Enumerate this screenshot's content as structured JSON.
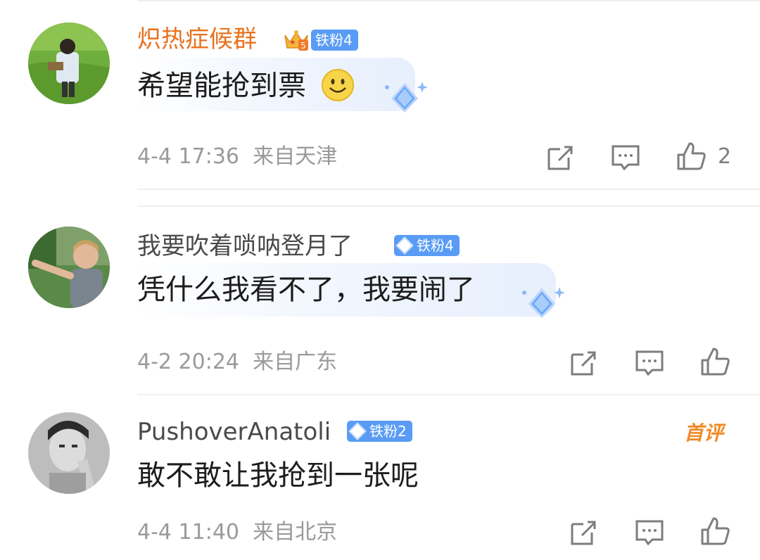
{
  "comments": [
    {
      "username": "炽热症候群",
      "username_color": "#e8711f",
      "fan_badge": "铁粉4",
      "has_crown": true,
      "crown_level": "5",
      "content": "希望能抢到票",
      "emoji": "smiley-emoji",
      "timestamp": "4-4 17:36",
      "location": "来自天津",
      "likes": "2"
    },
    {
      "username": "我要吹着唢呐登月了",
      "username_color": "#4a4a4a",
      "fan_badge": "铁粉4",
      "has_crown": false,
      "content": "凭什么我看不了，我要闹了",
      "timestamp": "4-2 20:24",
      "location": "来自广东",
      "likes": ""
    },
    {
      "username": "PushoverAnatoli",
      "username_color": "#4a4a4a",
      "fan_badge": "铁粉2",
      "has_crown": false,
      "first_comment_label": "首评",
      "content": "敢不敢让我抢到一张呢",
      "timestamp": "4-4 11:40",
      "location": "来自北京",
      "likes": ""
    }
  ],
  "icons": {
    "repost": "repost-icon",
    "comment": "comment-icon",
    "like": "like-icon"
  }
}
